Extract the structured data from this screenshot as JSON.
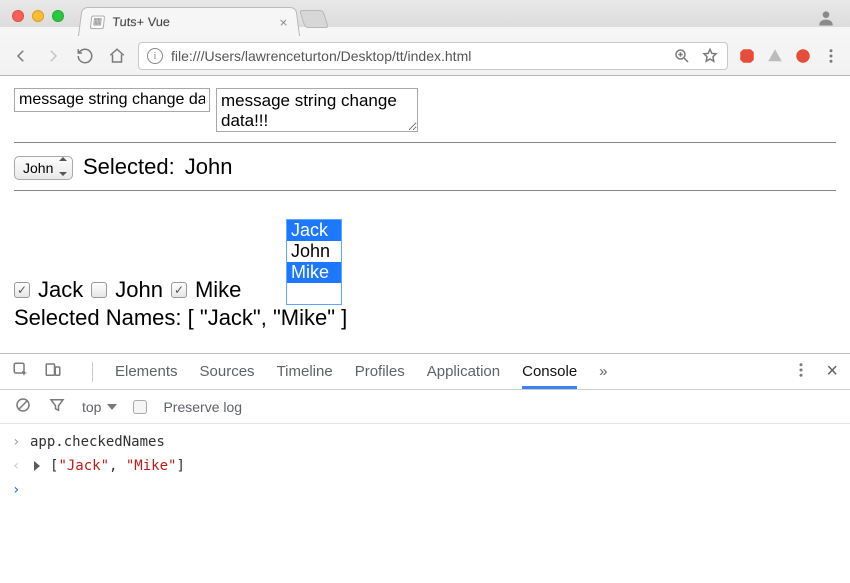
{
  "browser": {
    "tab_title": "Tuts+ Vue",
    "url": "file:///Users/lawrenceturton/Desktop/tt/index.html"
  },
  "content": {
    "text_input_value": "message string change data!!!",
    "textarea_value": "message string change data!!!",
    "dropdown_value": "John",
    "selected_label": "Selected:",
    "selected_value": "John",
    "checkboxes": [
      {
        "label": "Jack",
        "checked": true
      },
      {
        "label": "John",
        "checked": false
      },
      {
        "label": "Mike",
        "checked": true
      }
    ],
    "multiselect": [
      {
        "label": "Jack",
        "selected": true
      },
      {
        "label": "John",
        "selected": false
      },
      {
        "label": "Mike",
        "selected": true
      }
    ],
    "selected_names_label": "Selected Names:",
    "selected_names_display": "[ \"Jack\", \"Mike\" ]"
  },
  "devtools": {
    "tabs": [
      "Elements",
      "Sources",
      "Timeline",
      "Profiles",
      "Application",
      "Console"
    ],
    "active_tab": "Console",
    "overflow": "»",
    "context": "top",
    "preserve_log_label": "Preserve log",
    "console": {
      "input_expr": "app.checkedNames",
      "output_items": [
        "\"Jack\"",
        "\"Mike\""
      ]
    }
  }
}
